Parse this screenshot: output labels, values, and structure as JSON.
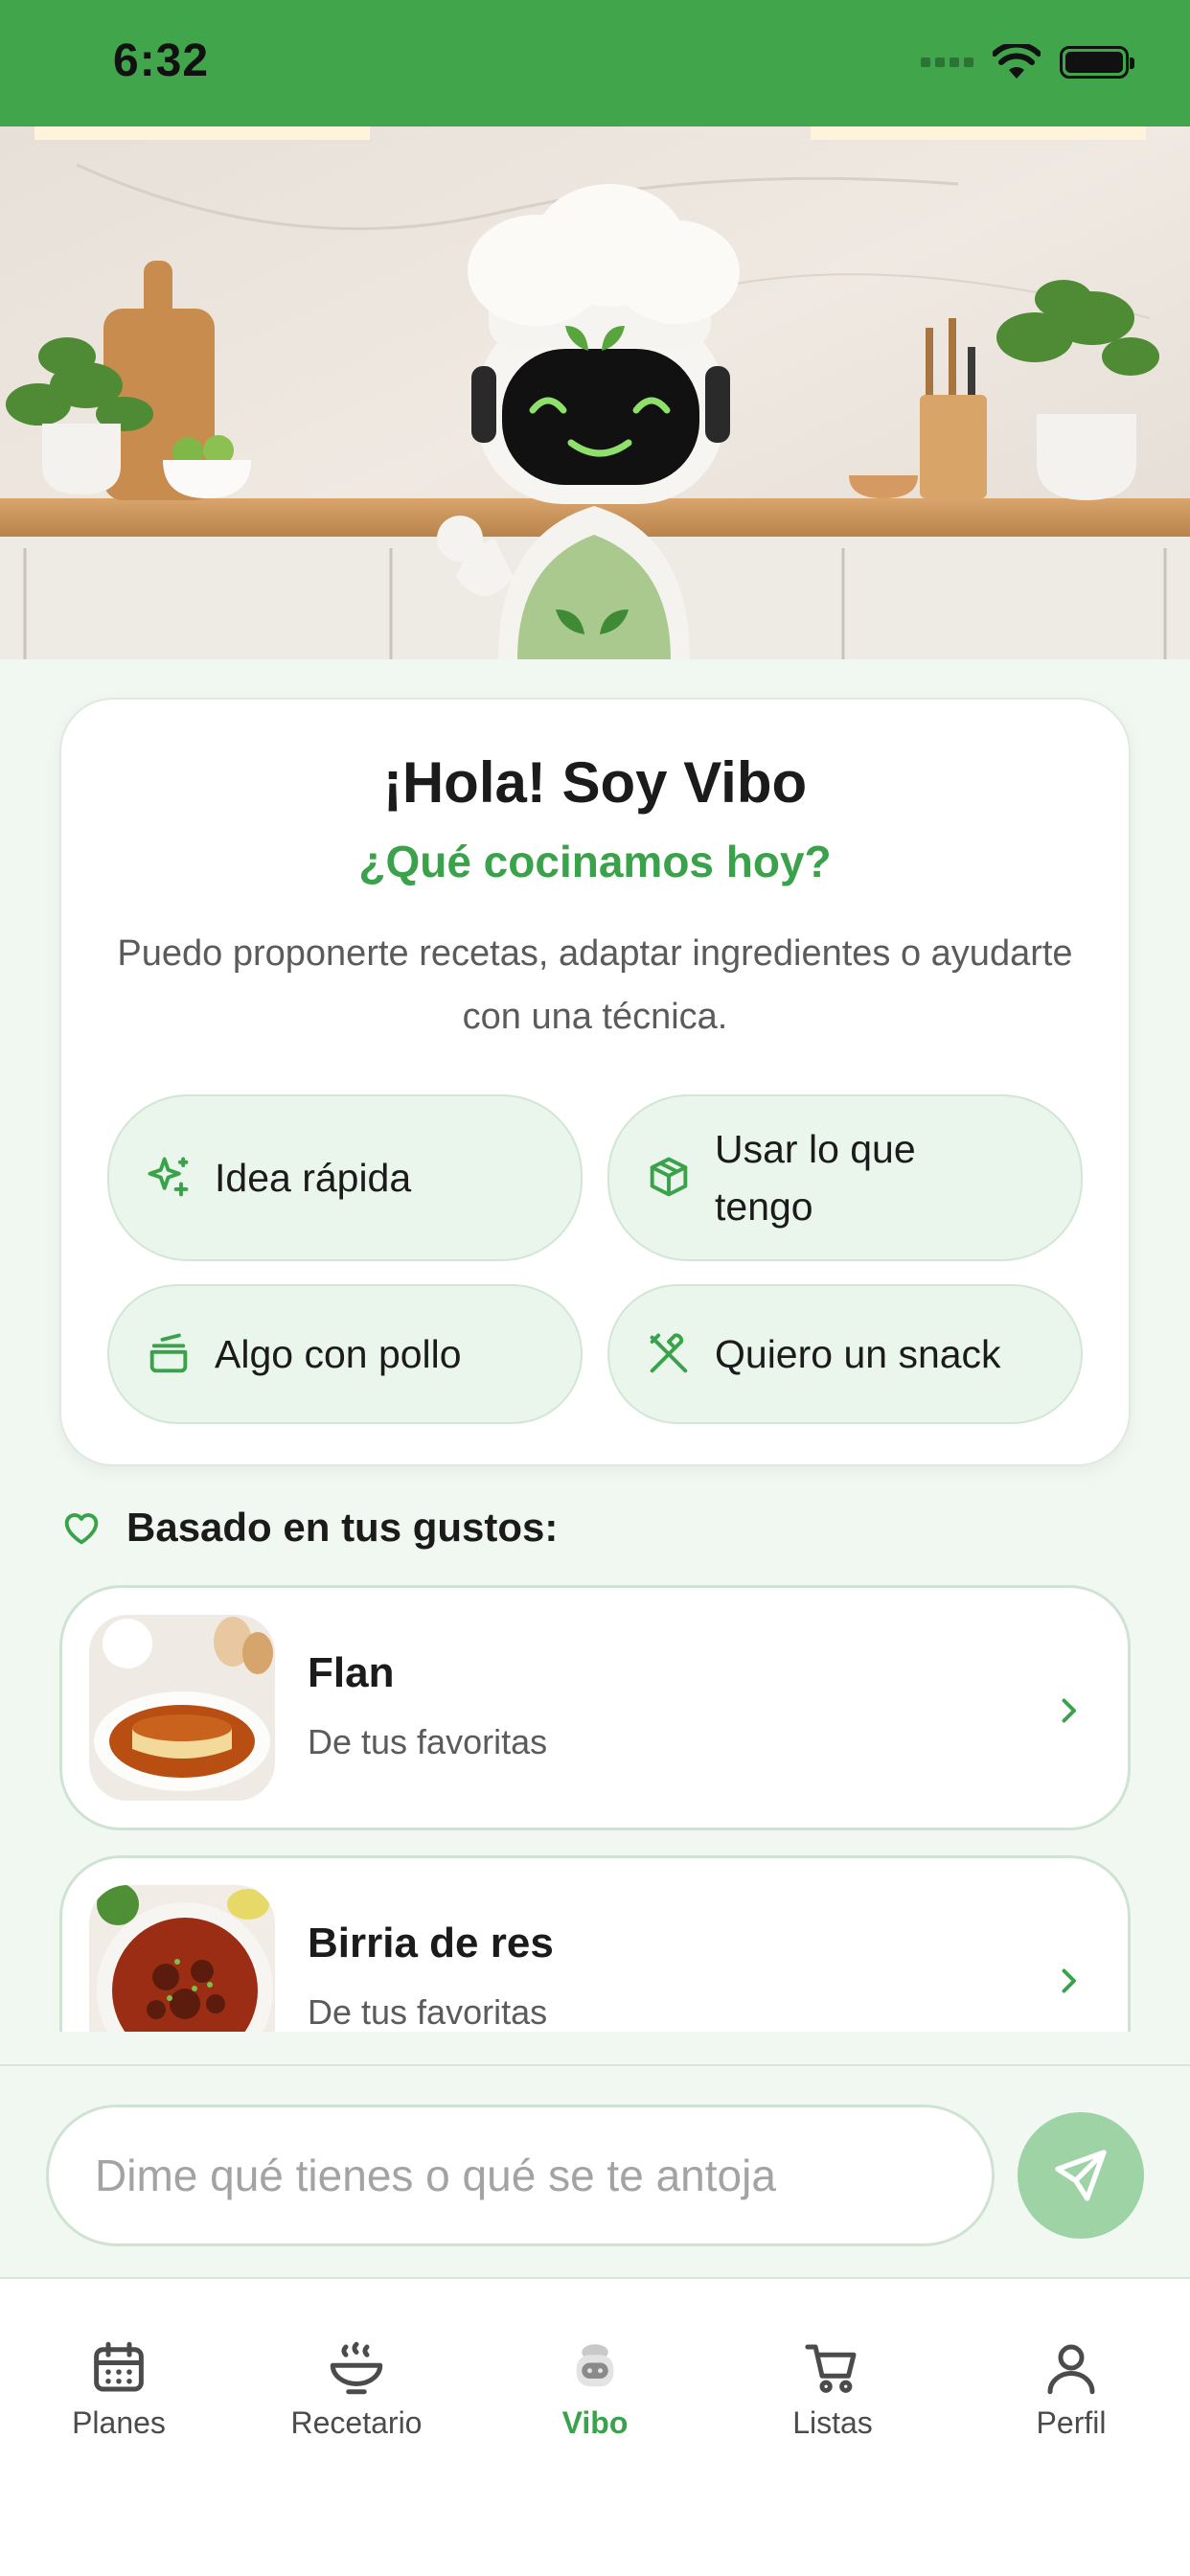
{
  "status_bar": {
    "time": "6:32"
  },
  "hero": {
    "badge_icon": "leaf-icon"
  },
  "greeting": {
    "title": "¡Hola! Soy Vibo",
    "subtitle": "¿Qué cocinamos hoy?",
    "description": "Puedo proponerte recetas, adaptar ingredientes o ayudarte con una técnica."
  },
  "quick_actions": [
    {
      "label": "Idea rápida",
      "icon": "sparkles-icon"
    },
    {
      "label": "Usar lo que tengo",
      "icon": "box-icon"
    },
    {
      "label": "Algo con pollo",
      "icon": "pot-icon"
    },
    {
      "label": "Quiero un snack",
      "icon": "utensils-crossed-icon"
    }
  ],
  "suggestions": {
    "heading": "Basado en tus gustos:",
    "items": [
      {
        "name": "Flan",
        "meta": "De tus favoritas"
      },
      {
        "name": "Birria de res",
        "meta": "De tus favoritas"
      }
    ]
  },
  "composer": {
    "placeholder": "Dime qué tienes o qué se te antoja"
  },
  "tabs": [
    {
      "label": "Planes",
      "icon": "calendar-icon"
    },
    {
      "label": "Recetario",
      "icon": "bowl-icon"
    },
    {
      "label": "Vibo",
      "icon": "robot-icon",
      "active": true
    },
    {
      "label": "Listas",
      "icon": "cart-icon"
    },
    {
      "label": "Perfil",
      "icon": "user-icon"
    }
  ],
  "colors": {
    "primary": "#40a54b",
    "accent_text": "#3aa24a",
    "background": "#f1f8f2",
    "send_button": "#9ed3a5"
  }
}
